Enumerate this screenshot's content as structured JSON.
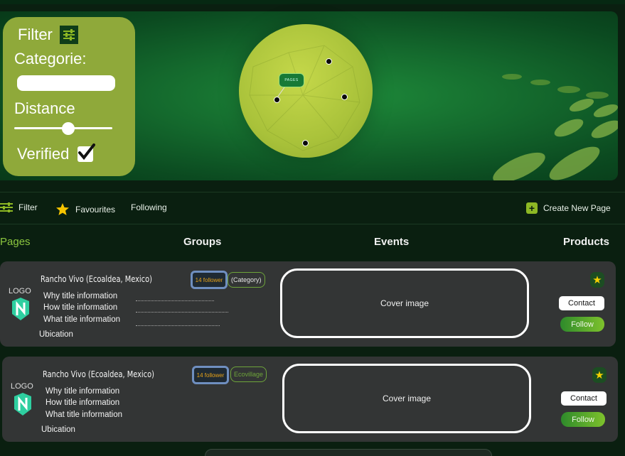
{
  "filter_panel": {
    "title": "Filter",
    "category_label": "Categorie:",
    "distance_label": "Distance",
    "distance_level": 0.55,
    "verified_label": "Verified",
    "verified_checked": true
  },
  "map": {
    "pages_tag": "PAGES"
  },
  "toolbar": {
    "filter": "Filter",
    "favourites": "Favourites",
    "following": "Following",
    "create": "Create New Page"
  },
  "tabs": {
    "pages": "Pages",
    "groups": "Groups",
    "events": "Events",
    "products": "Products"
  },
  "cards": [
    {
      "logo": "LOGO",
      "title": "Rancho Vivo (Ecoaldea, Mexico)",
      "followers": "14 follower",
      "category": "(Category)",
      "why": "Why title information",
      "how": "How title information",
      "what": "What title information",
      "ubication": "Ubication",
      "cover": "Cover image",
      "contact": "Contact",
      "follow": "Follow"
    },
    {
      "logo": "LOGO",
      "title": "Rancho Vivo (Ecoaldea, Mexico)",
      "followers": "14 follower",
      "category": "Ecovillage",
      "why": "Why title information",
      "how": "How title information",
      "what": "What title information",
      "ubication": "Ubication",
      "cover": "Cover image",
      "contact": "Contact",
      "follow": "Follow"
    }
  ],
  "colors": {
    "accent_green": "#8cc63f",
    "filter_panel": "#8fa93a",
    "card_bg": "#333535",
    "follower_text": "#e8a318"
  }
}
